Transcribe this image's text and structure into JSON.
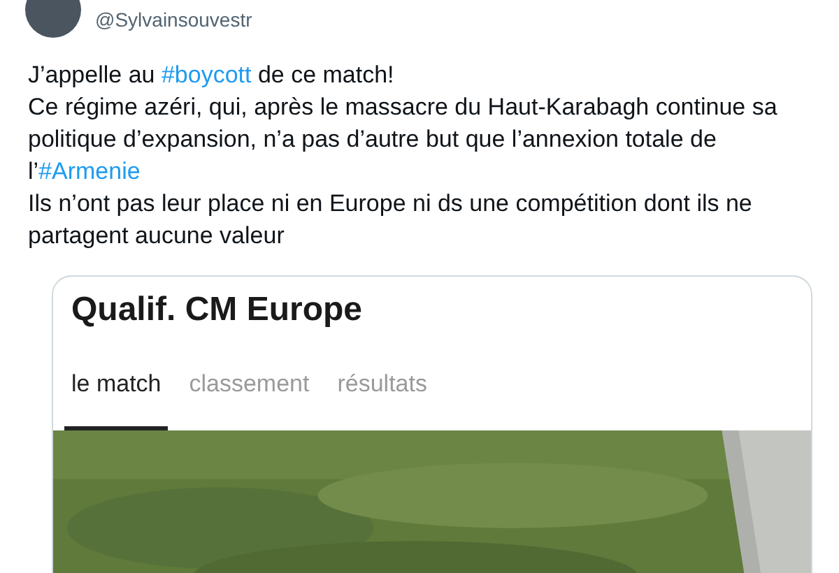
{
  "author": {
    "handle": "@Sylvainsouvestr"
  },
  "tweet": {
    "paragraphs": [
      [
        {
          "kind": "text",
          "text": "J’appelle au "
        },
        {
          "kind": "hashtag",
          "text": "#boycott"
        },
        {
          "kind": "text",
          "text": " de ce match!"
        }
      ],
      [
        {
          "kind": "text",
          "text": "Ce régime azéri, qui, après le massacre du Haut-Karabagh continue sa politique d’expansion, n’a pas d’autre but que l’annexion totale de l’"
        },
        {
          "kind": "hashtag",
          "text": "#Armenie"
        }
      ],
      [
        {
          "kind": "text",
          "text": "Ils n’ont pas leur place ni en Europe ni ds une compétition dont ils ne partagent aucune valeur"
        }
      ]
    ]
  },
  "card": {
    "title": "Qualif. CM Europe",
    "tabs": [
      {
        "label": "le match",
        "selected": true
      },
      {
        "label": "classement",
        "selected": false
      },
      {
        "label": "résultats",
        "selected": false
      }
    ]
  }
}
